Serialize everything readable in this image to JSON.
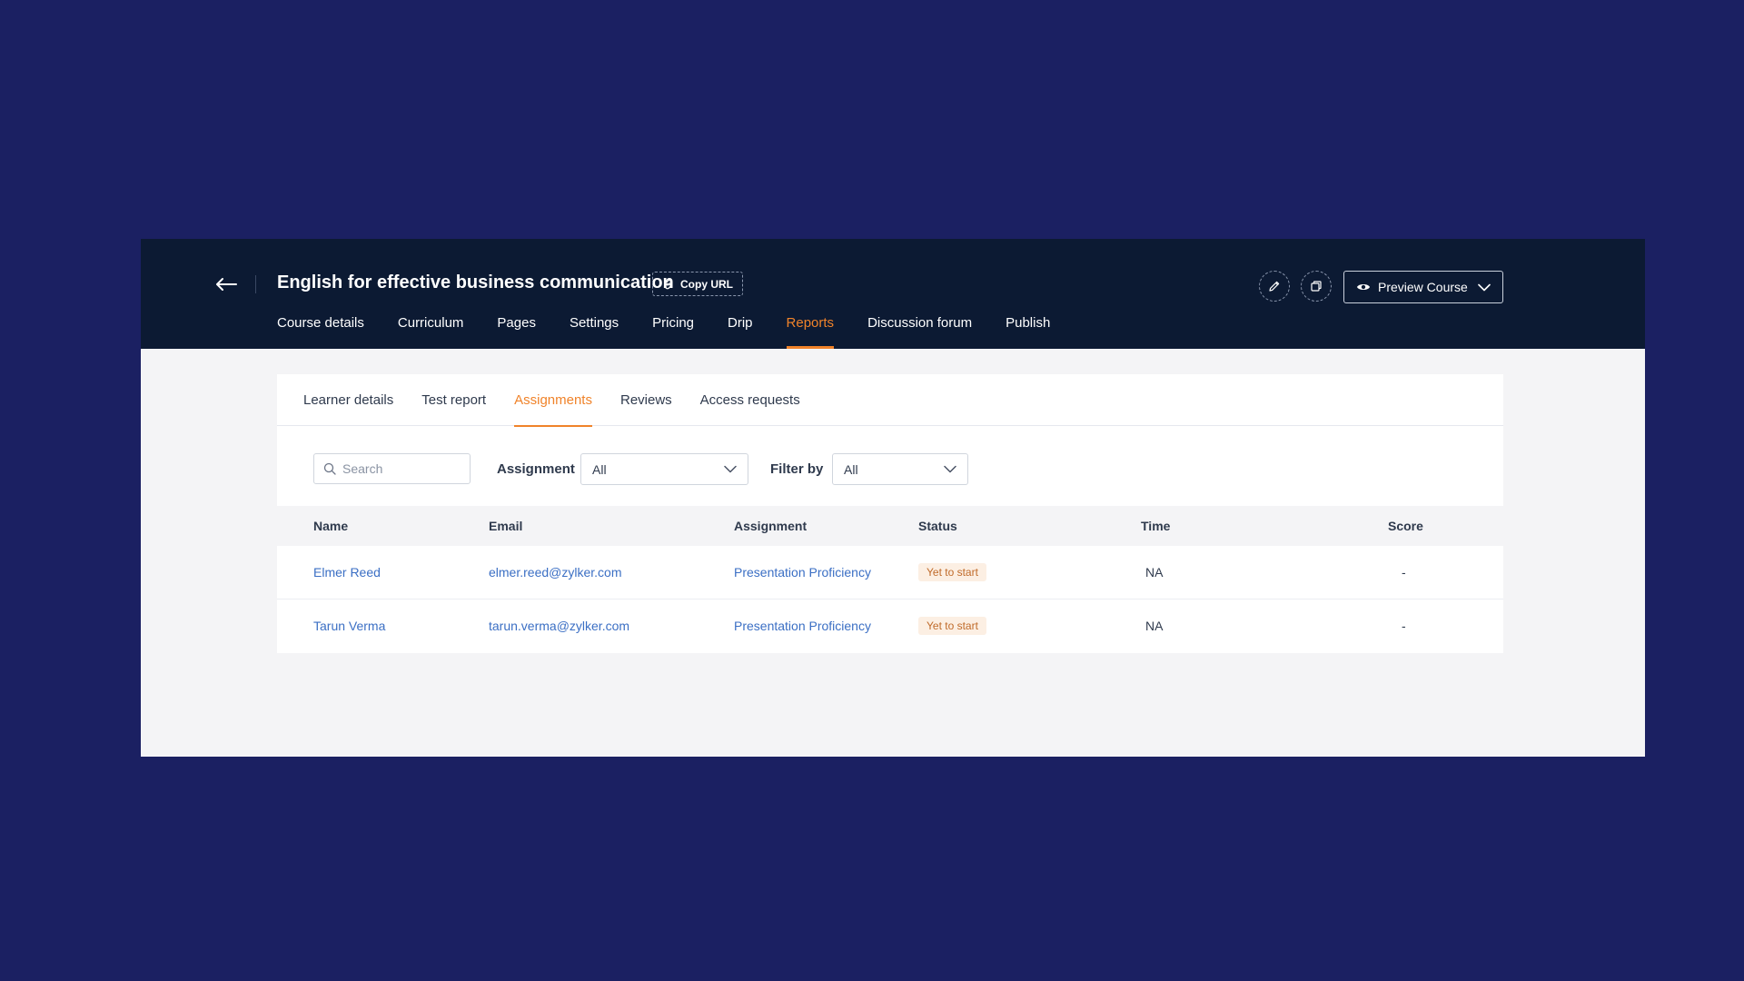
{
  "header": {
    "course_title": "English for effective business communication",
    "copy_url_label": "Copy URL",
    "preview_label": "Preview Course"
  },
  "main_tabs": [
    {
      "label": "Course details"
    },
    {
      "label": "Curriculum"
    },
    {
      "label": "Pages"
    },
    {
      "label": "Settings"
    },
    {
      "label": "Pricing"
    },
    {
      "label": "Drip"
    },
    {
      "label": "Reports",
      "active": true
    },
    {
      "label": "Discussion forum"
    },
    {
      "label": "Publish"
    }
  ],
  "sub_tabs": [
    {
      "label": "Learner details"
    },
    {
      "label": "Test report"
    },
    {
      "label": "Assignments",
      "active": true
    },
    {
      "label": "Reviews"
    },
    {
      "label": "Access requests"
    }
  ],
  "filters": {
    "search_placeholder": "Search",
    "assignment_label": "Assignment",
    "assignment_value": "All",
    "filter_by_label": "Filter by",
    "filter_by_value": "All"
  },
  "table": {
    "columns": [
      "Name",
      "Email",
      "Assignment",
      "Status",
      "Time",
      "Score"
    ],
    "rows": [
      {
        "name": "Elmer Reed",
        "email": "elmer.reed@zylker.com",
        "assignment": "Presentation Proficiency",
        "status": "Yet to start",
        "time": "NA",
        "score": "-"
      },
      {
        "name": "Tarun Verma",
        "email": "tarun.verma@zylker.com",
        "assignment": "Presentation Proficiency",
        "status": "Yet to start",
        "time": "NA",
        "score": "-"
      }
    ]
  },
  "colors": {
    "background": "#1b2062",
    "topbar": "#0c1a33",
    "accent": "#f0832a",
    "link": "#3b6fc4",
    "badge_bg": "#fcefe3",
    "badge_text": "#c06b2a"
  },
  "icons": [
    "back-arrow-icon",
    "link-icon",
    "pencil-icon",
    "duplicate-icon",
    "eye-icon",
    "chevron-down-icon",
    "search-icon"
  ]
}
